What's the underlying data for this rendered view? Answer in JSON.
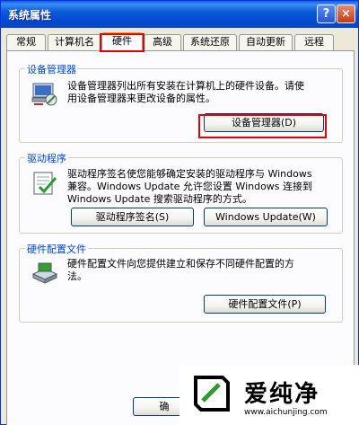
{
  "window": {
    "title": "系统属性",
    "help_label": "?",
    "close_label": "×"
  },
  "tabs": [
    {
      "label": "常规"
    },
    {
      "label": "计算机名"
    },
    {
      "label": "硬件"
    },
    {
      "label": "高级"
    },
    {
      "label": "系统还原"
    },
    {
      "label": "自动更新"
    },
    {
      "label": "远程"
    }
  ],
  "device_manager": {
    "title": "设备管理器",
    "desc_line1": "设备管理器列出所有安装在计算机上的硬件设备。请使",
    "desc_line2": "用设备管理器来更改设备的属性。",
    "button": "设备管理器(D)"
  },
  "drivers": {
    "title": "驱动程序",
    "desc_line1": "驱动程序签名使您能够确定安装的驱动程序与 Windows",
    "desc_line2": "兼容。Windows Update 允许您设置 Windows 连接到",
    "desc_line3": "Windows Update 搜索驱动程序的方式。",
    "signing_button": "驱动程序签名(S)",
    "update_button": "Windows Update(W)"
  },
  "hardware_profiles": {
    "title": "硬件配置文件",
    "desc_line1": "硬件配置文件向您提供建立和保存不同硬件配置的方",
    "desc_line2": "法。",
    "button": "硬件配置文件(P)"
  },
  "footer": {
    "ok_partial": "确"
  },
  "watermark": {
    "text": "爱纯净",
    "url": "www.aichunjing.com"
  },
  "colors": {
    "highlight": "#e60000",
    "group_title": "#0046d5",
    "titlebar": "#0249d1"
  }
}
